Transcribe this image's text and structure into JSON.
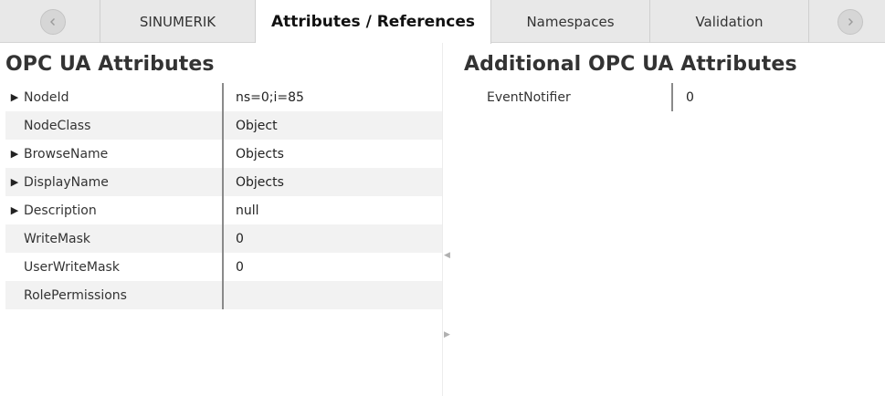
{
  "tabs": {
    "prev_icon": "chevron-left-icon",
    "next_icon": "chevron-right-icon",
    "items": [
      {
        "label": "SINUMERIK",
        "active": false
      },
      {
        "label": "Attributes / References",
        "active": true
      },
      {
        "label": "Namespaces",
        "active": false
      },
      {
        "label": "Validation",
        "active": false
      }
    ]
  },
  "left": {
    "title": "OPC UA Attributes",
    "rows": [
      {
        "name": "NodeId",
        "value": "ns=0;i=85",
        "expandable": true
      },
      {
        "name": "NodeClass",
        "value": "Object",
        "expandable": false
      },
      {
        "name": "BrowseName",
        "value": "Objects",
        "expandable": true
      },
      {
        "name": "DisplayName",
        "value": "Objects",
        "expandable": true
      },
      {
        "name": "Description",
        "value": "null",
        "expandable": true
      },
      {
        "name": "WriteMask",
        "value": "0",
        "expandable": false
      },
      {
        "name": "UserWriteMask",
        "value": "0",
        "expandable": false
      },
      {
        "name": "RolePermissions",
        "value": "",
        "expandable": false
      }
    ]
  },
  "right": {
    "title": "Additional OPC UA Attributes",
    "rows": [
      {
        "name": "EventNotifier",
        "value": "0"
      }
    ]
  },
  "colors": {
    "tabbar_bg": "#e8e8e8",
    "active_tab_bg": "#ffffff",
    "row_alt_bg": "#f2f2f2",
    "divider": "#8a8a8a"
  }
}
